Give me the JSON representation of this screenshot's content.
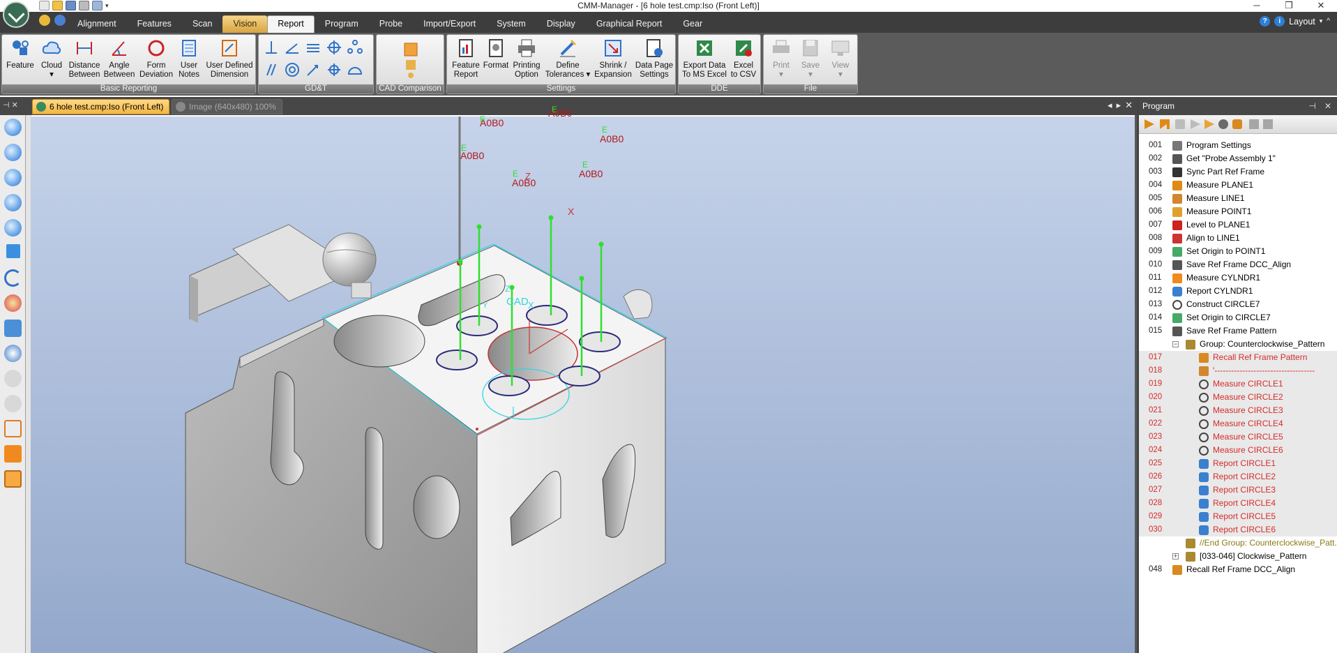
{
  "window": {
    "title": "CMM-Manager - [6 hole test.cmp:Iso (Front Left)]",
    "controls": [
      "─",
      "❐",
      "✕"
    ]
  },
  "menu": {
    "tabs": [
      "Alignment",
      "Features",
      "Scan",
      "Vision",
      "Report",
      "Program",
      "Probe",
      "Import/Export",
      "System",
      "Display",
      "Graphical Report",
      "Gear"
    ],
    "active_tab": "Report",
    "highlighted_tab": "Vision",
    "layout_label": "Layout"
  },
  "ribbon": {
    "basic_reporting": {
      "label": "Basic Reporting",
      "buttons": [
        {
          "line1": "Feature",
          "line2": ""
        },
        {
          "line1": "Cloud",
          "line2": "▾"
        },
        {
          "line1": "Distance",
          "line2": "Between"
        },
        {
          "line1": "Angle",
          "line2": "Between"
        },
        {
          "line1": "Form",
          "line2": "Deviation"
        },
        {
          "line1": "User",
          "line2": "Notes"
        },
        {
          "line1": "User Defined",
          "line2": "Dimension"
        }
      ]
    },
    "gdt": {
      "label": "GD&T"
    },
    "cad_comparison": {
      "label": "CAD Comparison"
    },
    "settings": {
      "label": "Settings",
      "buttons": [
        {
          "line1": "Feature",
          "line2": "Report"
        },
        {
          "line1": "Format",
          "line2": ""
        },
        {
          "line1": "Printing",
          "line2": "Option"
        },
        {
          "line1": "Define",
          "line2": "Tolerances ▾"
        },
        {
          "line1": "Shrink /",
          "line2": "Expansion"
        },
        {
          "line1": "Data Page",
          "line2": "Settings"
        }
      ]
    },
    "dde": {
      "label": "DDE",
      "buttons": [
        {
          "line1": "Export Data",
          "line2": "To MS Excel"
        },
        {
          "line1": "Excel",
          "line2": "to CSV"
        }
      ]
    },
    "file": {
      "label": "File",
      "buttons": [
        {
          "line1": "Print",
          "line2": "▾"
        },
        {
          "line1": "Save",
          "line2": "▾"
        },
        {
          "line1": "View",
          "line2": "▾"
        }
      ]
    }
  },
  "documents": {
    "tabs": [
      "6 hole test.cmp:Iso (Front Left)",
      "Image (640x480) 100%"
    ],
    "active": 0
  },
  "viewport": {
    "labels": [
      "A0B0",
      "A0B0",
      "A0B0",
      "A0B0",
      "A0B0",
      "A0B0"
    ],
    "hole_markers": [
      "E",
      "E",
      "E",
      "E",
      "E",
      "E"
    ],
    "cad_label": "CAD",
    "axis_labels": {
      "x": "X",
      "z": "Z",
      "cad_x": "X",
      "cad_z": "Z",
      "y": "Y"
    },
    "colors": {
      "label": "#b01818",
      "probe_line": "#2ee02e",
      "cad_edge": "#35d3e0",
      "background_top": "#c6d3ea",
      "background_bottom": "#93a8cb"
    }
  },
  "program_panel": {
    "title": "Program",
    "rows": [
      {
        "num": "001",
        "icon": "wrench-icon",
        "text": "Program Settings"
      },
      {
        "num": "002",
        "icon": "probe-assembly-icon",
        "text": "Get \"Probe Assembly 1\""
      },
      {
        "num": "003",
        "icon": "sync-frame-icon",
        "text": "Sync Part Ref Frame"
      },
      {
        "num": "004",
        "icon": "plane-icon",
        "text": "Measure PLANE1"
      },
      {
        "num": "005",
        "icon": "line-icon",
        "text": "Measure LINE1"
      },
      {
        "num": "006",
        "icon": "point-icon",
        "text": "Measure POINT1"
      },
      {
        "num": "007",
        "icon": "level-icon",
        "text": "Level to PLANE1"
      },
      {
        "num": "008",
        "icon": "align-icon",
        "text": "Align to LINE1"
      },
      {
        "num": "009",
        "icon": "origin-icon",
        "text": "Set Origin to POINT1"
      },
      {
        "num": "010",
        "icon": "save-frame-icon",
        "text": "Save Ref Frame DCC_Align"
      },
      {
        "num": "011",
        "icon": "cylinder-icon",
        "text": "Measure CYLNDR1"
      },
      {
        "num": "012",
        "icon": "report-icon",
        "text": "Report CYLNDR1"
      },
      {
        "num": "013",
        "icon": "circle-icon",
        "text": "Construct CIRCLE7"
      },
      {
        "num": "014",
        "icon": "origin-icon",
        "text": "Set Origin to CIRCLE7"
      },
      {
        "num": "015",
        "icon": "save-frame-icon",
        "text": "Save Ref Frame Pattern"
      },
      {
        "num": "",
        "icon": "group-icon",
        "text": "Group: Counterclockwise_Pattern",
        "tree": "−",
        "indent": 1
      },
      {
        "num": "017",
        "icon": "recall-frame-icon",
        "text": "Recall Ref Frame Pattern",
        "sel": true,
        "indent": 2
      },
      {
        "num": "018",
        "icon": "comment-icon",
        "text": "'------------------------------------",
        "sel": true,
        "indent": 2
      },
      {
        "num": "019",
        "icon": "circle-icon",
        "text": "Measure CIRCLE1",
        "sel": true,
        "indent": 2
      },
      {
        "num": "020",
        "icon": "circle-icon",
        "text": "Measure CIRCLE2",
        "sel": true,
        "indent": 2
      },
      {
        "num": "021",
        "icon": "circle-icon",
        "text": "Measure CIRCLE3",
        "sel": true,
        "indent": 2
      },
      {
        "num": "022",
        "icon": "circle-icon",
        "text": "Measure CIRCLE4",
        "sel": true,
        "indent": 2
      },
      {
        "num": "023",
        "icon": "circle-icon",
        "text": "Measure CIRCLE5",
        "sel": true,
        "indent": 2
      },
      {
        "num": "024",
        "icon": "circle-icon",
        "text": "Measure CIRCLE6",
        "sel": true,
        "indent": 2
      },
      {
        "num": "025",
        "icon": "report-icon",
        "text": "Report CIRCLE1",
        "sel": true,
        "indent": 2
      },
      {
        "num": "026",
        "icon": "report-icon",
        "text": "Report CIRCLE2",
        "sel": true,
        "indent": 2
      },
      {
        "num": "027",
        "icon": "report-icon",
        "text": "Report CIRCLE3",
        "sel": true,
        "indent": 2
      },
      {
        "num": "028",
        "icon": "report-icon",
        "text": "Report CIRCLE4",
        "sel": true,
        "indent": 2
      },
      {
        "num": "029",
        "icon": "report-icon",
        "text": "Report CIRCLE5",
        "sel": true,
        "indent": 2
      },
      {
        "num": "030",
        "icon": "report-icon",
        "text": "Report CIRCLE6",
        "sel": true,
        "indent": 2
      },
      {
        "num": "",
        "icon": "group-end-icon",
        "text": "//End Group: Counterclockwise_Patt...",
        "olive": true,
        "indent": 1
      },
      {
        "num": "",
        "icon": "group-icon",
        "text": "[033-046] Clockwise_Pattern",
        "tree": "+",
        "indent": 1
      },
      {
        "num": "048",
        "icon": "recall-frame-icon",
        "text": "Recall Ref Frame DCC_Align"
      }
    ]
  }
}
